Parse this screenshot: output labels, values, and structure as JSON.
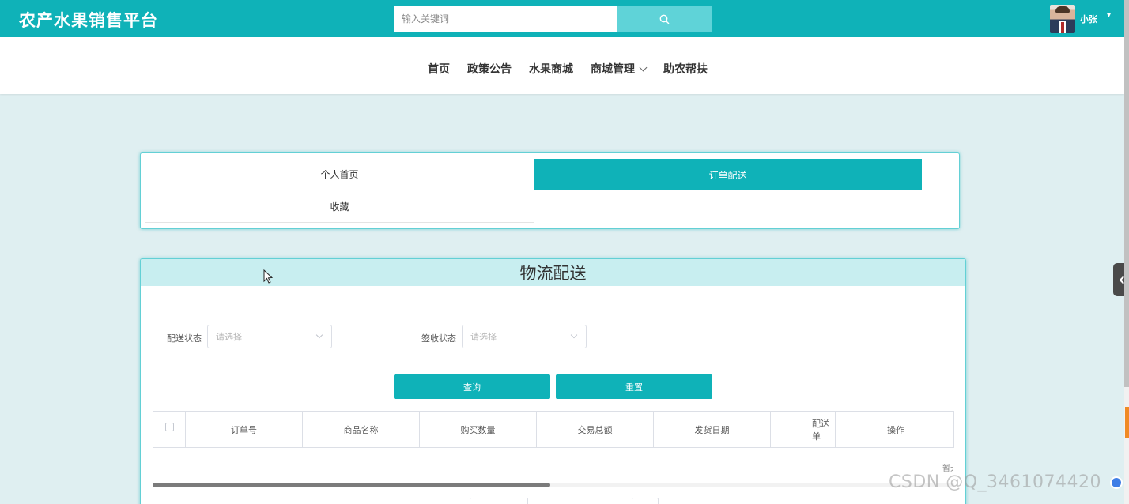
{
  "header": {
    "brand": "农产水果销售平台",
    "search_placeholder": "输入关键词",
    "username": "小张",
    "user_caret": "▾"
  },
  "nav": {
    "items": [
      "首页",
      "政策公告",
      "水果商城",
      "商城管理",
      "助农帮扶"
    ]
  },
  "tabs": {
    "items": [
      "个人首页",
      "订单配送",
      "收藏"
    ],
    "active": "订单配送"
  },
  "main": {
    "title": "物流配送",
    "filters": {
      "delivery_status_label": "配送状态",
      "delivery_status_placeholder": "请选择",
      "receipt_status_label": "签收状态",
      "receipt_status_placeholder": "请选择"
    },
    "buttons": {
      "query": "查询",
      "reset": "重置"
    },
    "table": {
      "columns": [
        "订单号",
        "商品名称",
        "购买数量",
        "交易总额",
        "发货日期",
        "配送单",
        "操作"
      ],
      "empty_text": "暂无数据"
    }
  },
  "watermark": "CSDN @Q_3461074420",
  "colors": {
    "primary": "#0fb2b8",
    "search_button": "#5fd3d8",
    "title_bar": "#c8eef0",
    "page_background": "#dfeff1"
  }
}
